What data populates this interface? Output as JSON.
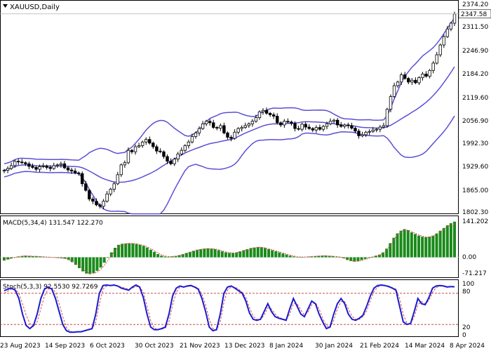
{
  "header": {
    "symbol_label": "XAUUSD,Daily"
  },
  "price_panel": {
    "y_ticks": [
      "2374.20",
      "2311.50",
      "2246.90",
      "2184.20",
      "2119.60",
      "2056.90",
      "1992.30",
      "1929.60",
      "1865.00",
      "1802.30"
    ],
    "current_price_label": "2347.58"
  },
  "macd_panel": {
    "label": "MACD(5,34,4) 131.547 122.270",
    "y_ticks": [
      "141.202",
      "0.00",
      "-71.217"
    ]
  },
  "stoch_panel": {
    "label": "Stoch(5,3,3) 92.5530 92.7269",
    "y_ticks": [
      "100",
      "80",
      "20",
      "0"
    ]
  },
  "x_axis": {
    "date_labels": [
      "23 Aug 2023",
      "14 Sep 2023",
      "6 Oct 2023",
      "30 Oct 2023",
      "21 Nov 2023",
      "13 Dec 2023",
      "8 Jan 2024",
      "30 Jan 2024",
      "21 Feb 2024",
      "14 Mar 2024",
      "8 Apr 2024"
    ]
  },
  "colors": {
    "bollinger_band": "#5b4fd6",
    "candle_body": "#000000",
    "macd_histogram": "#1a8a1a",
    "macd_signal": "#e05050",
    "stoch_main": "#1a1ad0",
    "stoch_signal": "#d05050",
    "level_line": "#c03030"
  },
  "chart_data": [
    {
      "type": "candlestick",
      "title": "XAUUSD,Daily",
      "ylim": [
        1802.3,
        2374.2
      ],
      "x_labels": [
        "23 Aug 2023",
        "14 Sep 2023",
        "6 Oct 2023",
        "30 Oct 2023",
        "21 Nov 2023",
        "13 Dec 2023",
        "8 Jan 2024",
        "30 Jan 2024",
        "21 Feb 2024",
        "14 Mar 2024",
        "8 Apr 2024"
      ],
      "close": [
        1917,
        1922,
        1930,
        1942,
        1940,
        1938,
        1935,
        1928,
        1925,
        1920,
        1927,
        1929,
        1925,
        1922,
        1930,
        1932,
        1935,
        1924,
        1918,
        1915,
        1910,
        1908,
        1880,
        1862,
        1838,
        1832,
        1822,
        1818,
        1832,
        1852,
        1865,
        1880,
        1905,
        1932,
        1938,
        1972,
        1968,
        1982,
        1985,
        1995,
        2002,
        1992,
        1982,
        1970,
        1968,
        1955,
        1942,
        1935,
        1948,
        1962,
        1972,
        1985,
        1995,
        2010,
        2020,
        2032,
        2045,
        2052,
        2048,
        2035,
        2033,
        2040,
        2020,
        2008,
        2005,
        2022,
        2032,
        2035,
        2040,
        2045,
        2052,
        2062,
        2078,
        2082,
        2074,
        2070,
        2066,
        2048,
        2042,
        2052,
        2050,
        2046,
        2032,
        2030,
        2044,
        2036,
        2032,
        2028,
        2035,
        2030,
        2038,
        2045,
        2052,
        2055,
        2042,
        2038,
        2042,
        2040,
        2033,
        2025,
        2012,
        2015,
        2022,
        2024,
        2028,
        2030,
        2036,
        2040,
        2085,
        2120,
        2150,
        2160,
        2180,
        2170,
        2160,
        2165,
        2158,
        2172,
        2182,
        2176,
        2192,
        2212,
        2235,
        2262,
        2285,
        2306,
        2322,
        2347.58
      ],
      "bollinger": {
        "upper": "upper band",
        "middle": "middle band",
        "lower": "lower band"
      }
    },
    {
      "type": "bar",
      "title": "MACD(5,34,4) 131.547 122.270",
      "ylim": [
        -71.217,
        141.202
      ],
      "series": [
        {
          "name": "MACD",
          "values": [
            -12,
            -8,
            -4,
            0,
            3,
            5,
            6,
            5,
            4,
            4,
            3,
            2,
            1,
            0,
            -1,
            -2,
            -3,
            -5,
            -10,
            -18,
            -28,
            -40,
            -52,
            -60,
            -62,
            -58,
            -50,
            -38,
            -20,
            -2,
            18,
            35,
            46,
            50,
            51,
            52,
            51,
            49,
            46,
            42,
            36,
            28,
            20,
            12,
            6,
            3,
            2,
            3,
            5,
            8,
            12,
            16,
            20,
            24,
            28,
            30,
            32,
            33,
            32,
            30,
            26,
            22,
            18,
            16,
            16,
            18,
            22,
            26,
            30,
            34,
            36,
            38,
            37,
            34,
            30,
            26,
            22,
            18,
            14,
            10,
            6,
            3,
            1,
            0,
            1,
            2,
            3,
            4,
            5,
            6,
            6,
            5,
            4,
            2,
            0,
            -4,
            -10,
            -14,
            -16,
            -14,
            -10,
            -6,
            -2,
            2,
            6,
            10,
            18,
            32,
            52,
            72,
            88,
            98,
            104,
            100,
            92,
            86,
            80,
            76,
            74,
            76,
            80,
            88,
            98,
            108,
            118,
            126,
            131.547
          ]
        },
        {
          "name": "Signal",
          "values": [
            -10,
            -7,
            -4,
            -1,
            2,
            4,
            5,
            5,
            4,
            4,
            3,
            2,
            1,
            0,
            -1,
            -2,
            -3,
            -4,
            -8,
            -14,
            -22,
            -32,
            -44,
            -54,
            -60,
            -60,
            -55,
            -45,
            -30,
            -12,
            6,
            24,
            38,
            46,
            50,
            51,
            51,
            50,
            47,
            44,
            39,
            32,
            24,
            16,
            9,
            5,
            3,
            3,
            4,
            6,
            10,
            14,
            18,
            22,
            26,
            29,
            31,
            32,
            32,
            31,
            28,
            24,
            20,
            17,
            16,
            17,
            20,
            24,
            28,
            32,
            35,
            37,
            37,
            35,
            32,
            28,
            24,
            20,
            16,
            12,
            8,
            5,
            2,
            1,
            1,
            2,
            3,
            4,
            5,
            6,
            6,
            5,
            4,
            3,
            1,
            -2,
            -7,
            -12,
            -15,
            -15,
            -12,
            -8,
            -4,
            0,
            4,
            8,
            14,
            26,
            44,
            64,
            82,
            94,
            101,
            100,
            95,
            89,
            83,
            78,
            75,
            75,
            78,
            85,
            94,
            104,
            113,
            120,
            122.27
          ]
        }
      ]
    },
    {
      "type": "line",
      "title": "Stoch(5,3,3) 92.5530 92.7269",
      "ylim": [
        0,
        100
      ],
      "levels": [
        20,
        80
      ],
      "series": [
        {
          "name": "Main",
          "values": [
            85,
            88,
            90,
            86,
            70,
            40,
            18,
            12,
            18,
            40,
            70,
            88,
            92,
            88,
            70,
            45,
            20,
            8,
            5,
            5,
            6,
            6,
            8,
            10,
            12,
            40,
            80,
            95,
            96,
            95,
            96,
            94,
            90,
            88,
            86,
            92,
            96,
            92,
            72,
            40,
            15,
            10,
            10,
            12,
            15,
            40,
            75,
            90,
            94,
            92,
            94,
            95,
            92,
            88,
            70,
            45,
            15,
            8,
            10,
            40,
            80,
            92,
            94,
            90,
            85,
            80,
            65,
            42,
            30,
            28,
            30,
            45,
            60,
            45,
            35,
            32,
            30,
            28,
            50,
            70,
            55,
            40,
            35,
            50,
            65,
            60,
            40,
            25,
            12,
            15,
            40,
            60,
            70,
            60,
            40,
            30,
            28,
            32,
            38,
            55,
            75,
            90,
            95,
            96,
            95,
            93,
            90,
            86,
            55,
            25,
            20,
            22,
            45,
            70,
            60,
            58,
            72,
            90,
            94,
            95,
            94,
            92,
            93,
            92.553
          ]
        },
        {
          "name": "Signal",
          "values": [
            80,
            84,
            88,
            88,
            80,
            60,
            38,
            22,
            16,
            25,
            50,
            75,
            88,
            90,
            82,
            60,
            35,
            14,
            7,
            5,
            5,
            6,
            7,
            9,
            11,
            25,
            60,
            88,
            94,
            95,
            95,
            94,
            92,
            90,
            88,
            90,
            93,
            93,
            82,
            55,
            28,
            13,
            10,
            11,
            13,
            25,
            58,
            82,
            92,
            93,
            93,
            94,
            93,
            90,
            78,
            58,
            30,
            12,
            9,
            25,
            62,
            86,
            92,
            92,
            88,
            82,
            72,
            52,
            36,
            30,
            29,
            38,
            52,
            50,
            40,
            34,
            31,
            29,
            40,
            60,
            60,
            48,
            38,
            44,
            58,
            62,
            50,
            32,
            18,
            14,
            28,
            50,
            64,
            64,
            50,
            36,
            30,
            30,
            35,
            46,
            66,
            83,
            92,
            95,
            95,
            94,
            91,
            88,
            70,
            40,
            22,
            21,
            35,
            58,
            64,
            60,
            66,
            82,
            91,
            94,
            94,
            93,
            93,
            92.7269
          ]
        }
      ]
    }
  ]
}
